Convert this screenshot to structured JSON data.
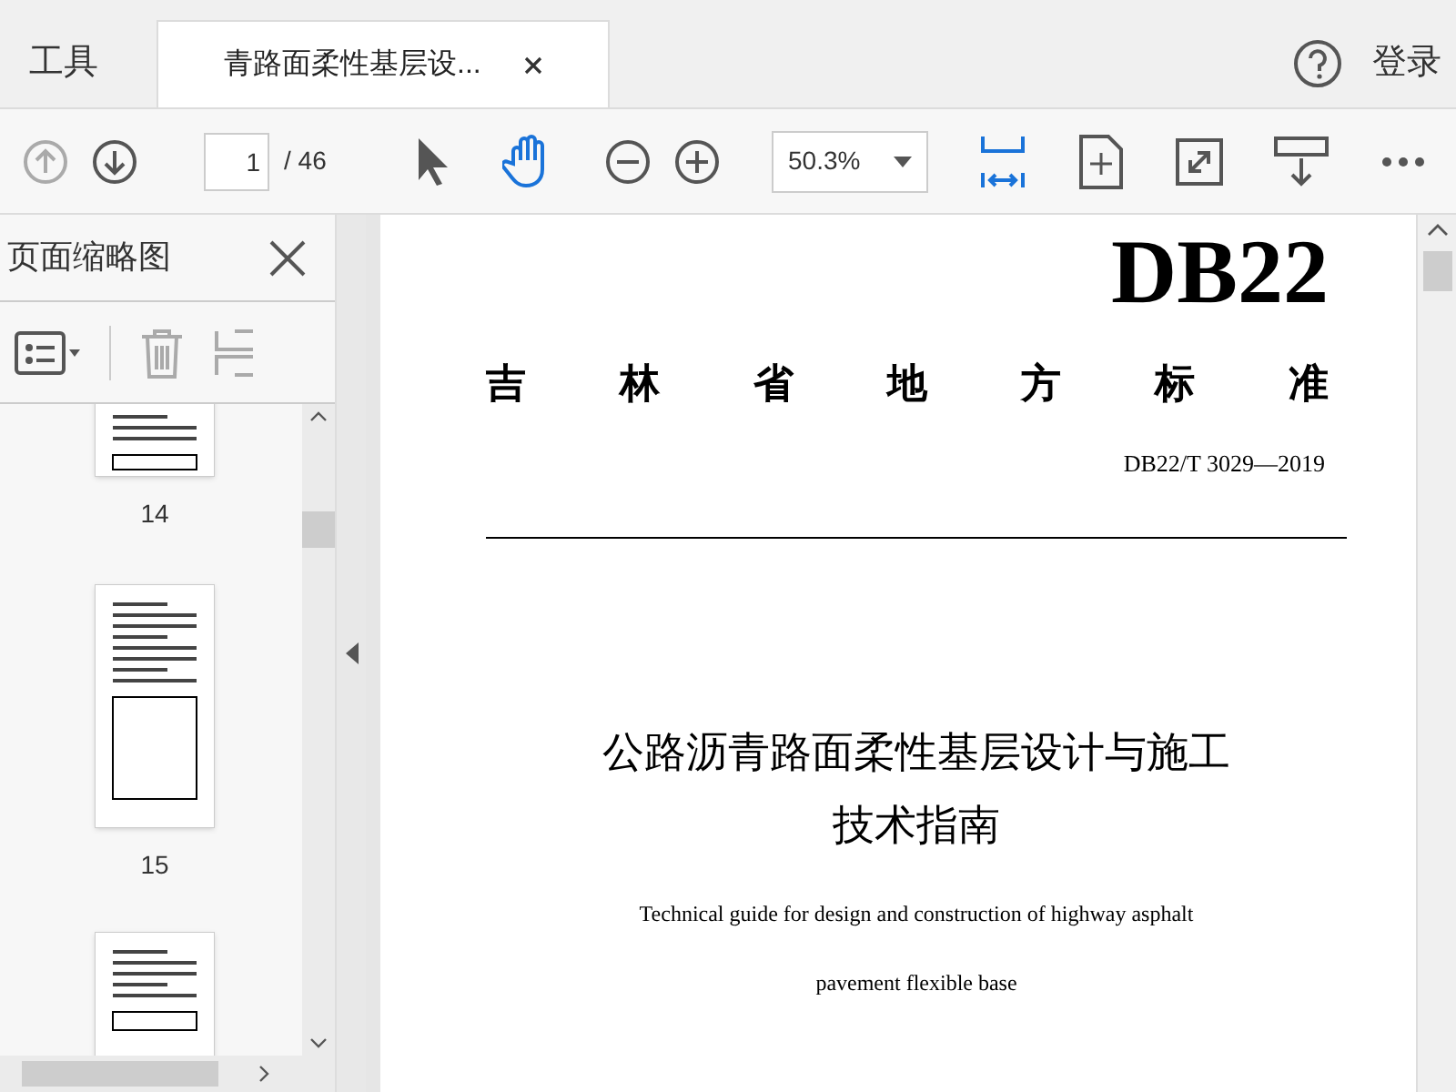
{
  "tabs": [
    {
      "label": "工具",
      "selected": false
    },
    {
      "label": "青路面柔性基层设...",
      "selected": true
    }
  ],
  "account": {
    "sign_in": "登录"
  },
  "toolbar": {
    "page_number": "1",
    "page_count": "/ 46",
    "zoom": "50.3%"
  },
  "sidebar": {
    "title": "页面缩略图",
    "thumbnails": [
      {
        "label": "14"
      },
      {
        "label": "15"
      }
    ]
  },
  "document": {
    "code": "DB22",
    "heading": "吉林省地方标准",
    "number": "DB22/T 3029—2019",
    "title_lines": [
      "公路沥青路面柔性基层设计与施工",
      "技术指南"
    ],
    "english_lines": [
      "Technical guide for design and construction of highway asphalt",
      "pavement flexible base"
    ]
  }
}
